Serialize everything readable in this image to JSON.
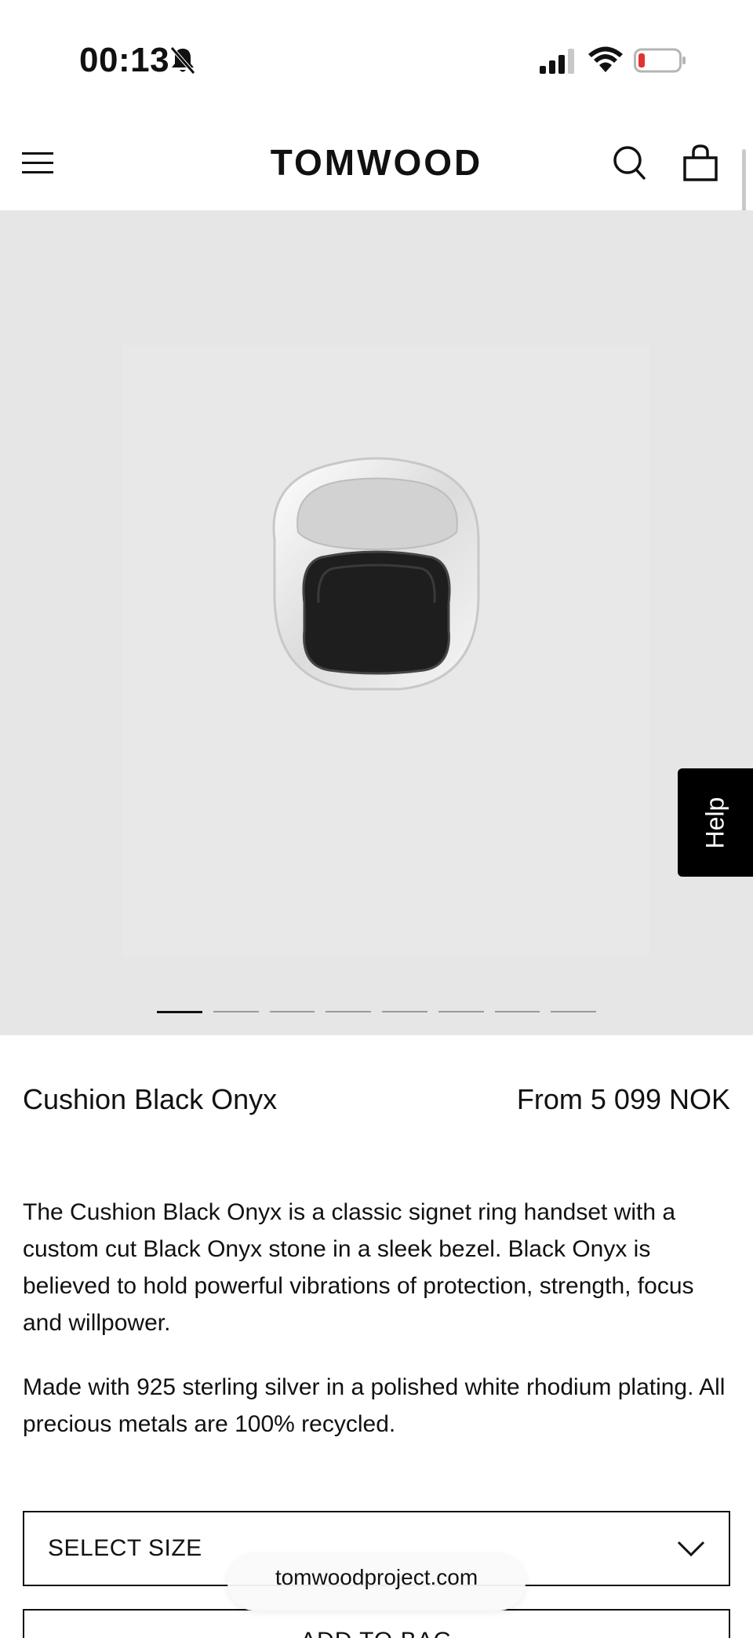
{
  "status_bar": {
    "time": "00:13",
    "icons": [
      "bell-slash-icon",
      "signal-icon",
      "wifi-icon",
      "battery-icon"
    ]
  },
  "header": {
    "logo": "TOMWOOD",
    "icons": [
      "menu-icon",
      "search-icon",
      "bag-icon"
    ]
  },
  "gallery": {
    "image_count": 8,
    "active_index": 0,
    "help_label": "Help"
  },
  "product": {
    "name": "Cushion Black Onyx",
    "price": "From 5 099 NOK",
    "description_1": "The Cushion Black Onyx is a classic signet ring handset with a custom cut Black Onyx stone in a sleek bezel. Black Onyx is believed to hold powerful vibrations of protection, strength, focus and willpower.",
    "description_2": "Made with 925 sterling silver in a polished white rhodium plating. All precious metals are 100% recycled."
  },
  "size_select": {
    "label": "SELECT SIZE"
  },
  "add_to_bag": {
    "label": "ADD TO BAG"
  },
  "browser": {
    "url": "tomwoodproject.com"
  },
  "colors": {
    "hero_bg": "#e6e6e6",
    "help_bg": "#000000",
    "battery_low": "#e0342f"
  }
}
